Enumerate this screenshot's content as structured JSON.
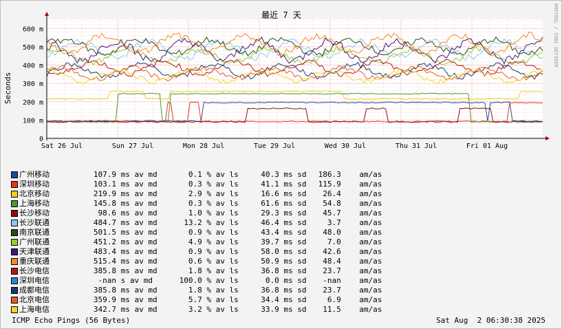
{
  "chart_data": {
    "type": "line",
    "title": "最近 7 天",
    "ylabel": "Seconds",
    "watermark": "RRDTOOL / TOBI OETIKER",
    "ylim": [
      0,
      650
    ],
    "yticks": [
      {
        "value": 0,
        "label": "0"
      },
      {
        "value": 100,
        "label": "100 m"
      },
      {
        "value": 200,
        "label": "200 m"
      },
      {
        "value": 300,
        "label": "300 m"
      },
      {
        "value": 400,
        "label": "400 m"
      },
      {
        "value": 500,
        "label": "500 m"
      },
      {
        "value": 600,
        "label": "600 m"
      }
    ],
    "xticks": [
      "Sat 26 Jul",
      "Sun 27 Jul",
      "Mon 28 Jul",
      "Tue 29 Jul",
      "Wed 30 Jul",
      "Thu 31 Jul",
      "Fri 01 Aug"
    ],
    "xrange_days": 7,
    "grid": true,
    "series": [
      {
        "name": "广州移动",
        "color": "#1f4e99",
        "median": "107.9",
        "loss": "0.1",
        "sd": "40.3",
        "amas": "186.3",
        "base": 95
      },
      {
        "name": "深圳移动",
        "color": "#e8341c",
        "median": "103.1",
        "loss": "0.3",
        "sd": "41.1",
        "amas": "115.9",
        "base": 92
      },
      {
        "name": "北京移动",
        "color": "#f2cf1b",
        "median": "219.9",
        "loss": "2.9",
        "sd": "16.6",
        "amas": "26.4",
        "base": 215
      },
      {
        "name": "上海移动",
        "color": "#4b9a2c",
        "median": "145.8",
        "loss": "0.3",
        "sd": "61.6",
        "amas": "54.8",
        "base": 90
      },
      {
        "name": "长沙移动",
        "color": "#8a0f0f",
        "median": "98.6",
        "loss": "1.0",
        "sd": "29.3",
        "amas": "45.7",
        "base": 90
      },
      {
        "name": "长沙联通",
        "color": "#8ec8f0",
        "median": "484.7",
        "loss": "13.2",
        "sd": "46.4",
        "amas": "3.7",
        "base": 485
      },
      {
        "name": "南京联通",
        "color": "#274a1a",
        "median": "501.5",
        "loss": "0.9",
        "sd": "43.4",
        "amas": "48.0",
        "base": 500
      },
      {
        "name": "广州联通",
        "color": "#9acd2e",
        "median": "451.2",
        "loss": "4.9",
        "sd": "39.7",
        "amas": "7.0",
        "base": 450
      },
      {
        "name": "天津联通",
        "color": "#3e1a7c",
        "median": "483.4",
        "loss": "0.9",
        "sd": "58.0",
        "amas": "42.6",
        "base": 480
      },
      {
        "name": "重庆联通",
        "color": "#f28a1e",
        "median": "515.4",
        "loss": "0.6",
        "sd": "50.9",
        "amas": "48.4",
        "base": 515
      },
      {
        "name": "长沙电信",
        "color": "#b3161b",
        "median": "385.8",
        "loss": "1.8",
        "sd": "36.8",
        "amas": "23.7",
        "base": 385
      },
      {
        "name": "深圳电信",
        "color": "#2a87c8",
        "median": "-nan",
        "loss": "100.0",
        "sd": "0.0",
        "amas": "-nan",
        "base": null
      },
      {
        "name": "成都电信",
        "color": "#0e3d6b",
        "median": "385.8",
        "loss": "1.8",
        "sd": "36.8",
        "amas": "23.7",
        "base": 370
      },
      {
        "name": "北京电信",
        "color": "#e85d1f",
        "median": "359.9",
        "loss": "5.7",
        "sd": "34.4",
        "amas": "6.9",
        "base": 355
      },
      {
        "name": "上海电信",
        "color": "#f7d22a",
        "median": "342.7",
        "loss": "3.2",
        "sd": "33.9",
        "amas": "11.5",
        "base": 340
      }
    ],
    "legend_units": {
      "median": "ms av md",
      "median_nan": "s av md",
      "loss": "% av ls",
      "sd": "ms sd",
      "amas": "am/as"
    }
  },
  "footer": {
    "left": "ICMP Echo Pings (56 Bytes)",
    "right": "Sat Aug  2 06:30:38 2025"
  }
}
